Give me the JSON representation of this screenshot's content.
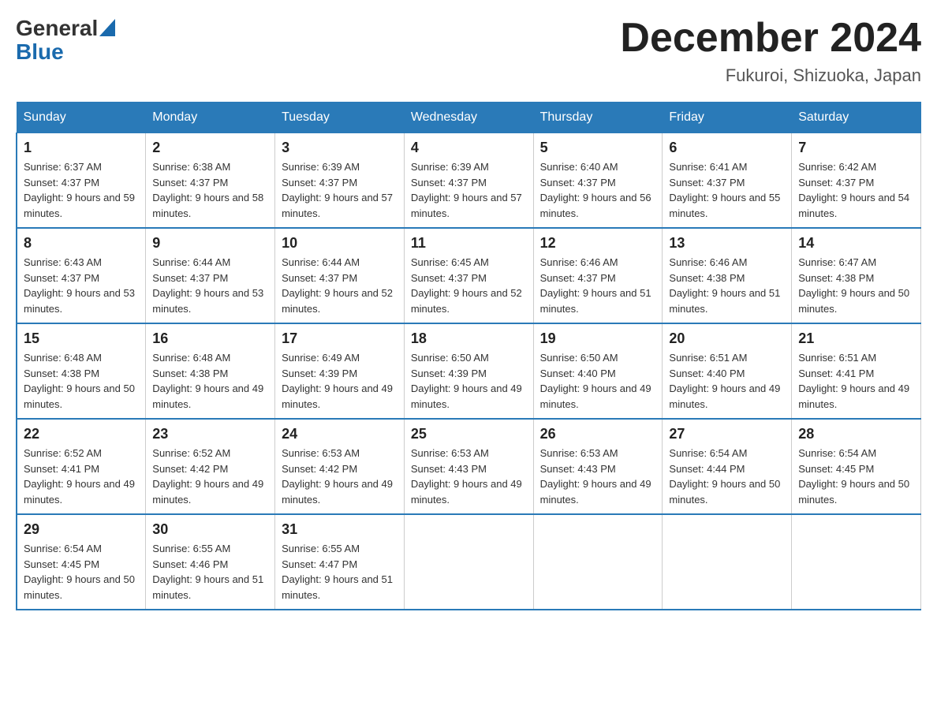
{
  "header": {
    "logo_general": "General",
    "logo_blue": "Blue",
    "title": "December 2024",
    "subtitle": "Fukuroi, Shizuoka, Japan"
  },
  "columns": [
    "Sunday",
    "Monday",
    "Tuesday",
    "Wednesday",
    "Thursday",
    "Friday",
    "Saturday"
  ],
  "weeks": [
    [
      {
        "day": "1",
        "sunrise": "6:37 AM",
        "sunset": "4:37 PM",
        "daylight": "9 hours and 59 minutes."
      },
      {
        "day": "2",
        "sunrise": "6:38 AM",
        "sunset": "4:37 PM",
        "daylight": "9 hours and 58 minutes."
      },
      {
        "day": "3",
        "sunrise": "6:39 AM",
        "sunset": "4:37 PM",
        "daylight": "9 hours and 57 minutes."
      },
      {
        "day": "4",
        "sunrise": "6:39 AM",
        "sunset": "4:37 PM",
        "daylight": "9 hours and 57 minutes."
      },
      {
        "day": "5",
        "sunrise": "6:40 AM",
        "sunset": "4:37 PM",
        "daylight": "9 hours and 56 minutes."
      },
      {
        "day": "6",
        "sunrise": "6:41 AM",
        "sunset": "4:37 PM",
        "daylight": "9 hours and 55 minutes."
      },
      {
        "day": "7",
        "sunrise": "6:42 AM",
        "sunset": "4:37 PM",
        "daylight": "9 hours and 54 minutes."
      }
    ],
    [
      {
        "day": "8",
        "sunrise": "6:43 AM",
        "sunset": "4:37 PM",
        "daylight": "9 hours and 53 minutes."
      },
      {
        "day": "9",
        "sunrise": "6:44 AM",
        "sunset": "4:37 PM",
        "daylight": "9 hours and 53 minutes."
      },
      {
        "day": "10",
        "sunrise": "6:44 AM",
        "sunset": "4:37 PM",
        "daylight": "9 hours and 52 minutes."
      },
      {
        "day": "11",
        "sunrise": "6:45 AM",
        "sunset": "4:37 PM",
        "daylight": "9 hours and 52 minutes."
      },
      {
        "day": "12",
        "sunrise": "6:46 AM",
        "sunset": "4:37 PM",
        "daylight": "9 hours and 51 minutes."
      },
      {
        "day": "13",
        "sunrise": "6:46 AM",
        "sunset": "4:38 PM",
        "daylight": "9 hours and 51 minutes."
      },
      {
        "day": "14",
        "sunrise": "6:47 AM",
        "sunset": "4:38 PM",
        "daylight": "9 hours and 50 minutes."
      }
    ],
    [
      {
        "day": "15",
        "sunrise": "6:48 AM",
        "sunset": "4:38 PM",
        "daylight": "9 hours and 50 minutes."
      },
      {
        "day": "16",
        "sunrise": "6:48 AM",
        "sunset": "4:38 PM",
        "daylight": "9 hours and 49 minutes."
      },
      {
        "day": "17",
        "sunrise": "6:49 AM",
        "sunset": "4:39 PM",
        "daylight": "9 hours and 49 minutes."
      },
      {
        "day": "18",
        "sunrise": "6:50 AM",
        "sunset": "4:39 PM",
        "daylight": "9 hours and 49 minutes."
      },
      {
        "day": "19",
        "sunrise": "6:50 AM",
        "sunset": "4:40 PM",
        "daylight": "9 hours and 49 minutes."
      },
      {
        "day": "20",
        "sunrise": "6:51 AM",
        "sunset": "4:40 PM",
        "daylight": "9 hours and 49 minutes."
      },
      {
        "day": "21",
        "sunrise": "6:51 AM",
        "sunset": "4:41 PM",
        "daylight": "9 hours and 49 minutes."
      }
    ],
    [
      {
        "day": "22",
        "sunrise": "6:52 AM",
        "sunset": "4:41 PM",
        "daylight": "9 hours and 49 minutes."
      },
      {
        "day": "23",
        "sunrise": "6:52 AM",
        "sunset": "4:42 PM",
        "daylight": "9 hours and 49 minutes."
      },
      {
        "day": "24",
        "sunrise": "6:53 AM",
        "sunset": "4:42 PM",
        "daylight": "9 hours and 49 minutes."
      },
      {
        "day": "25",
        "sunrise": "6:53 AM",
        "sunset": "4:43 PM",
        "daylight": "9 hours and 49 minutes."
      },
      {
        "day": "26",
        "sunrise": "6:53 AM",
        "sunset": "4:43 PM",
        "daylight": "9 hours and 49 minutes."
      },
      {
        "day": "27",
        "sunrise": "6:54 AM",
        "sunset": "4:44 PM",
        "daylight": "9 hours and 50 minutes."
      },
      {
        "day": "28",
        "sunrise": "6:54 AM",
        "sunset": "4:45 PM",
        "daylight": "9 hours and 50 minutes."
      }
    ],
    [
      {
        "day": "29",
        "sunrise": "6:54 AM",
        "sunset": "4:45 PM",
        "daylight": "9 hours and 50 minutes."
      },
      {
        "day": "30",
        "sunrise": "6:55 AM",
        "sunset": "4:46 PM",
        "daylight": "9 hours and 51 minutes."
      },
      {
        "day": "31",
        "sunrise": "6:55 AM",
        "sunset": "4:47 PM",
        "daylight": "9 hours and 51 minutes."
      },
      null,
      null,
      null,
      null
    ]
  ]
}
